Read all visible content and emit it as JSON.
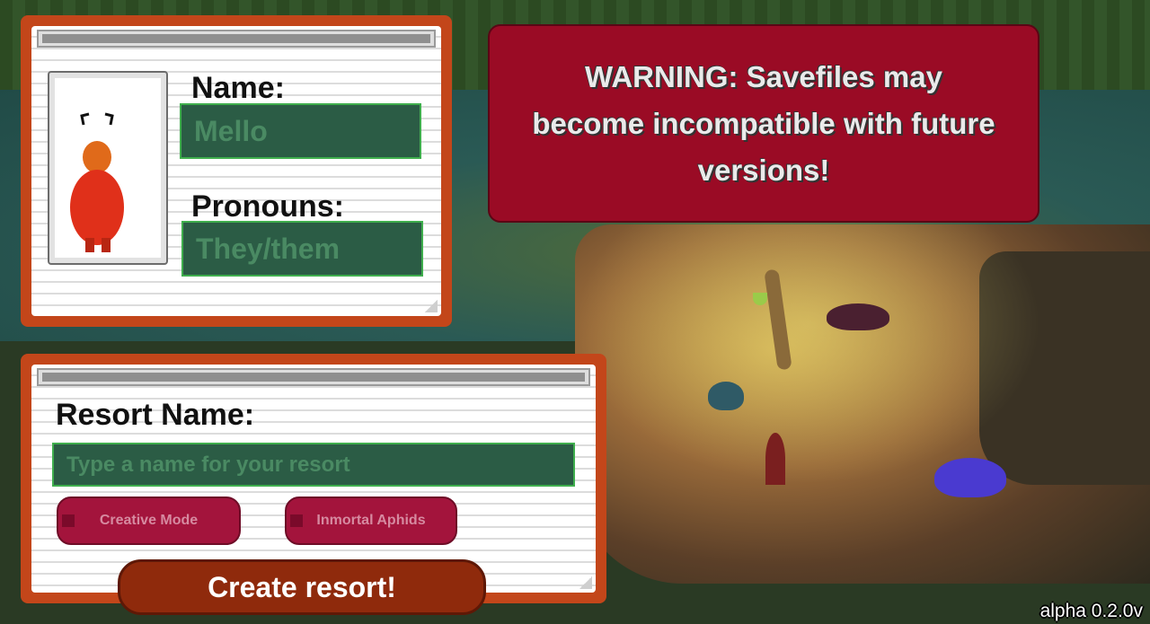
{
  "character_panel": {
    "name_label": "Name:",
    "name_value": "Mello",
    "pronouns_label": "Pronouns:",
    "pronouns_value": "They/them"
  },
  "resort_panel": {
    "resort_name_label": "Resort Name:",
    "resort_name_placeholder": "Type a name for your resort",
    "creative_mode_label": "Creative Mode",
    "immortal_aphids_label": "Inmortal Aphids",
    "create_button_label": "Create resort!"
  },
  "warning": {
    "text": "WARNING: Savefiles may become incompatible with future versions!"
  },
  "version": "alpha 0.2.0v",
  "colors": {
    "panel_frame": "#c3461a",
    "warning_bg": "#9a0b25",
    "field_bg": "#2b5c45",
    "toggle_bg": "#a3143c",
    "create_button_bg": "#8f2a0c"
  },
  "icons": {
    "portrait": "ant-character-sprite"
  }
}
